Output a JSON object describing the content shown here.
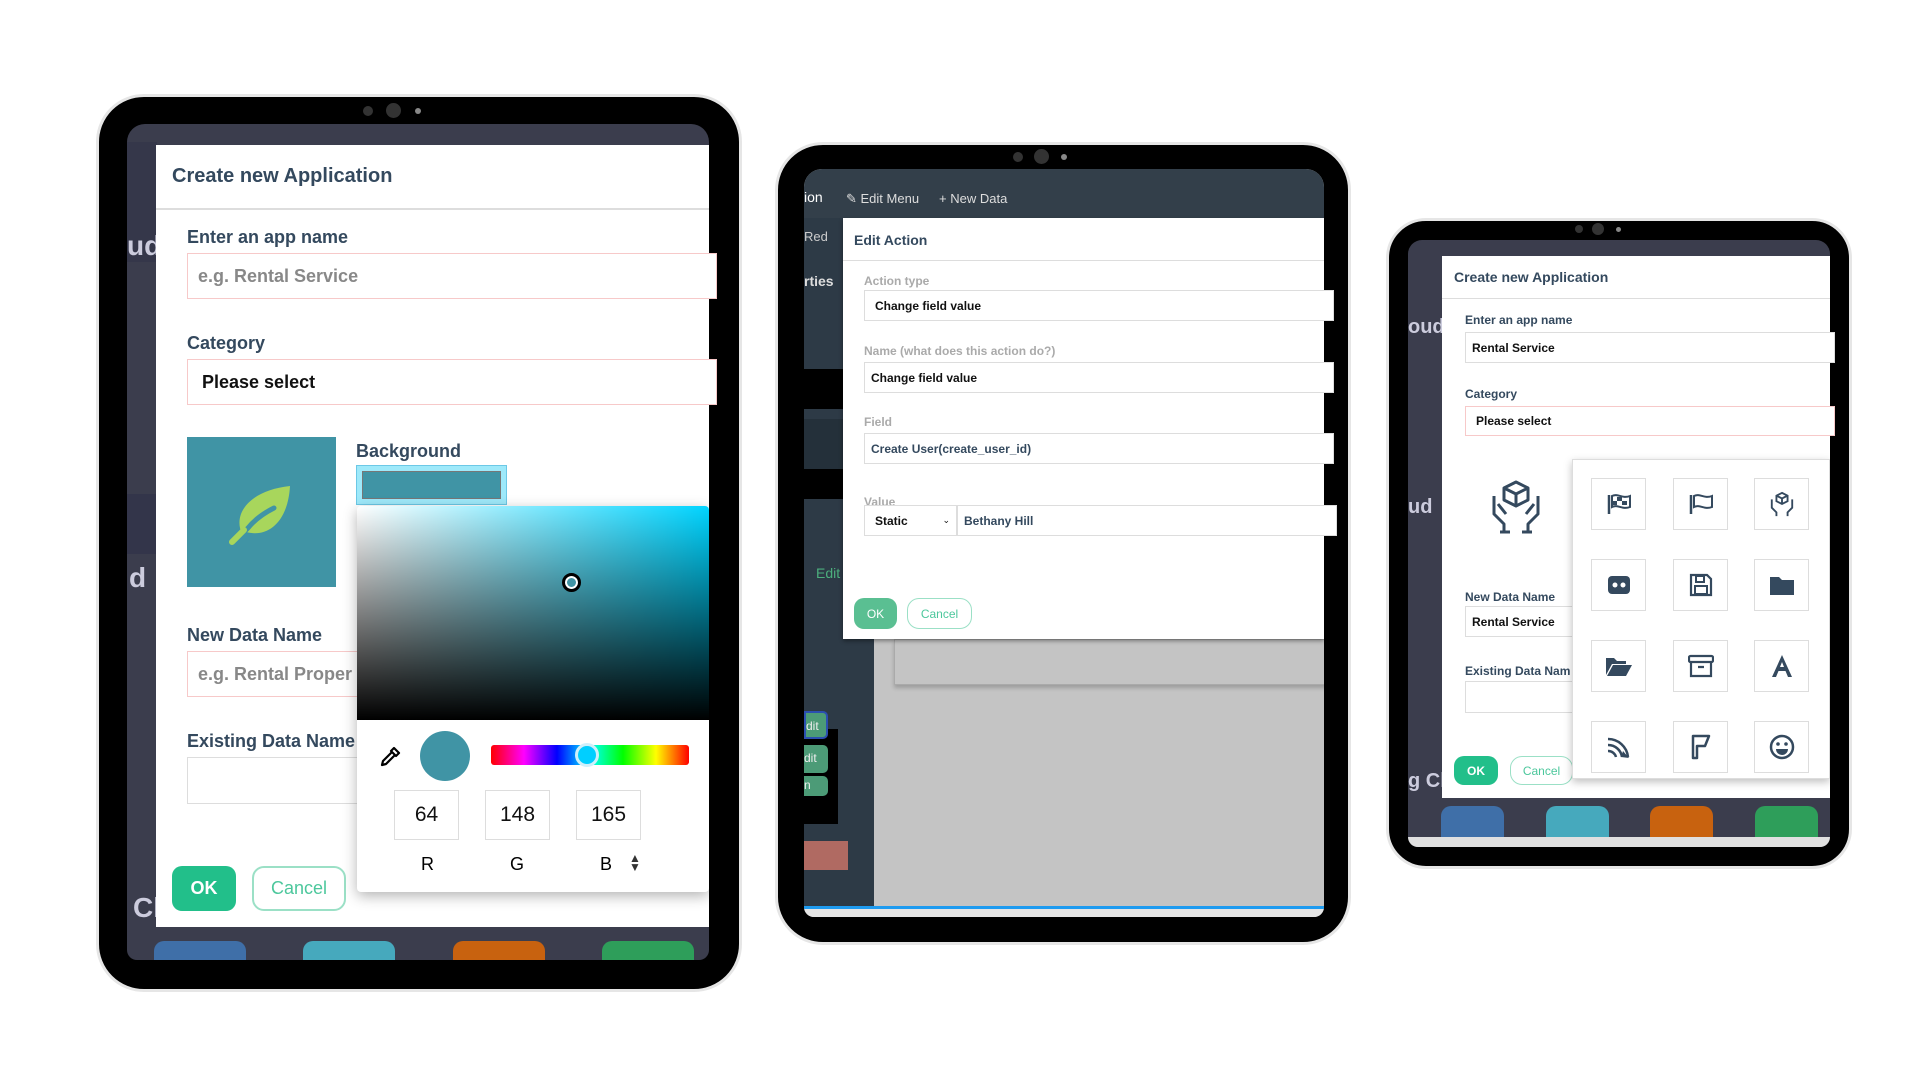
{
  "left": {
    "background_fragments": [
      "ud",
      "d",
      "Cl"
    ],
    "title": "Create new Application",
    "app_name_label": "Enter an app name",
    "app_name_placeholder": "e.g. Rental Service",
    "category_label": "Category",
    "category_value": "Please select",
    "background_label": "Background",
    "new_data_label": "New Data Name",
    "new_data_placeholder": "e.g. Rental Proper",
    "existing_data_label": "Existing Data Name",
    "ok": "OK",
    "cancel": "Cancel",
    "app_icon": "leaf-icon",
    "picker": {
      "color": "#4094a5",
      "r": "64",
      "g": "148",
      "b": "165",
      "r_label": "R",
      "g_label": "G",
      "b_label": "B",
      "hue_degrees": 190
    },
    "dock_colors": [
      "#3f6fa8",
      "#46a9bd",
      "#c8620f",
      "#2e9e5a"
    ]
  },
  "middle": {
    "toolbar": {
      "fragment": "ion",
      "edit_menu": "Edit Menu",
      "new_data": "New Data"
    },
    "side_fragments": {
      "redo": "Red",
      "properties": "rties",
      "edit": "Edit",
      "btn1": "dit",
      "btn2": "dit",
      "btn3": "n"
    },
    "modal": {
      "title": "Edit Action",
      "action_type_label": "Action type",
      "action_type_value": "Change field value",
      "name_label": "Name (what does this action do?)",
      "name_value": "Change field value",
      "field_label": "Field",
      "field_value": "Create User(create_user_id)",
      "value_label": "Value",
      "value_mode": "Static",
      "value_value": "Bethany Hill",
      "ok": "OK",
      "cancel": "Cancel"
    }
  },
  "right": {
    "background_fragments": [
      "oud",
      "ud",
      "g Cl"
    ],
    "title": "Create new Application",
    "app_name_label": "Enter an app name",
    "app_name_value": "Rental Service",
    "category_label": "Category",
    "category_value": "Please select",
    "new_data_label": "New Data Name",
    "new_data_value": "Rental Service",
    "existing_data_label": "Existing Data Nam",
    "ok": "OK",
    "cancel": "Cancel",
    "selected_icon": "hands-holding-box-icon",
    "icon_grid": [
      "flag-checkered-icon",
      "flag-icon",
      "hands-holding-box-icon",
      "robot-face-icon",
      "floppy-disk-icon",
      "folder-icon",
      "folder-open-icon",
      "archive-box-icon",
      "font-letter-a-icon",
      "signal-feed-icon",
      "flag-alt-icon",
      "grin-face-icon"
    ],
    "dock_colors": [
      "#3f6fa8",
      "#46a9bd",
      "#c8620f",
      "#2e9e5a"
    ]
  }
}
